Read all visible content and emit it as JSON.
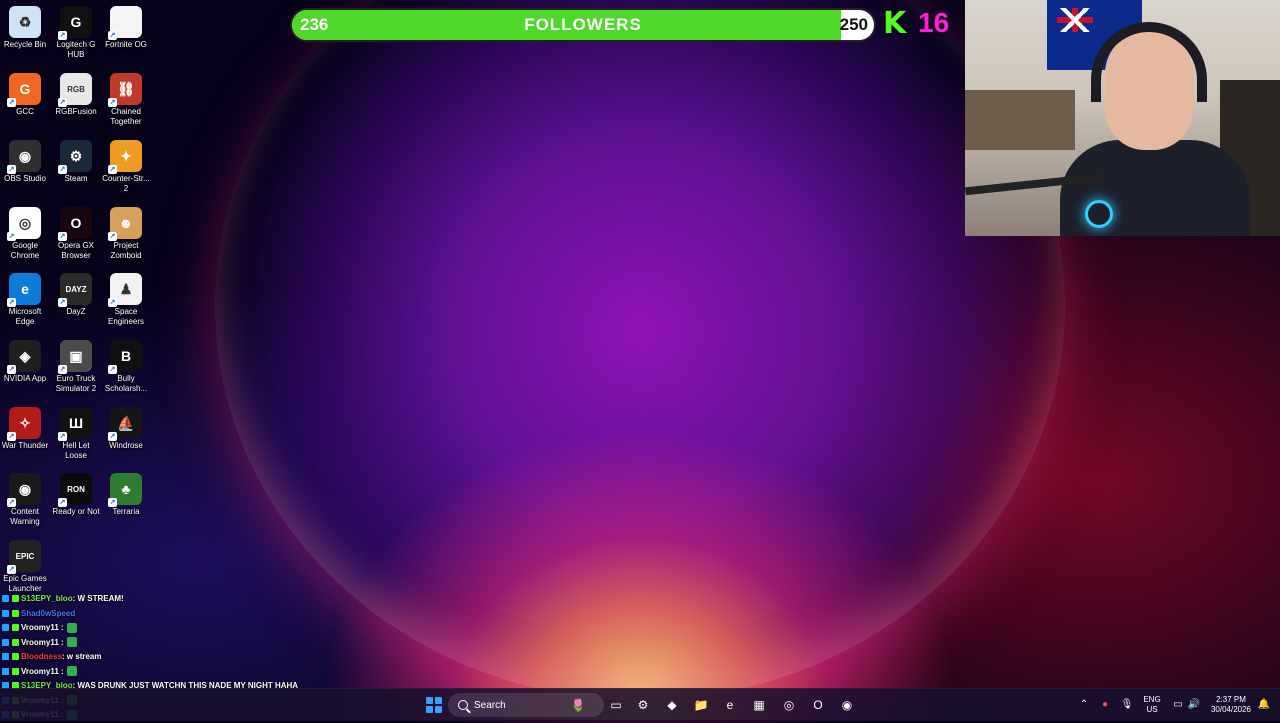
{
  "desktop_icons": [
    {
      "label": "Recycle Bin",
      "icon": "recycle-bin-icon",
      "color": "#cfe3f5",
      "glyph": "♻"
    },
    {
      "label": "Logitech G HUB",
      "icon": "logitech-g-hub-icon",
      "color": "#111111",
      "glyph": "G"
    },
    {
      "label": "Fortnite OG",
      "icon": "file-icon",
      "color": "#f4f4f4",
      "glyph": ""
    },
    {
      "label": "GCC",
      "icon": "gcc-icon",
      "color": "#f26522",
      "glyph": "G"
    },
    {
      "label": "RGBFusion",
      "icon": "rgbfusion-icon",
      "color": "#e8e8e8",
      "glyph": "RGB"
    },
    {
      "label": "Chained Together",
      "icon": "chained-together-icon",
      "color": "#c03a2b",
      "glyph": "⛓"
    },
    {
      "label": "OBS Studio",
      "icon": "obs-studio-icon",
      "color": "#302e31",
      "glyph": "◉"
    },
    {
      "label": "Steam",
      "icon": "steam-icon",
      "color": "#1b2838",
      "glyph": "⚙"
    },
    {
      "label": "Counter-Str... 2",
      "icon": "counter-strike-icon",
      "color": "#f09c24",
      "glyph": "✦"
    },
    {
      "label": "Google Chrome",
      "icon": "google-chrome-icon",
      "color": "#ffffff",
      "glyph": "◎"
    },
    {
      "label": "Opera GX Browser",
      "icon": "opera-gx-icon",
      "color": "#1a0610",
      "glyph": "O"
    },
    {
      "label": "Project Zomboid",
      "icon": "project-zomboid-icon",
      "color": "#d8a15a",
      "glyph": "☻"
    },
    {
      "label": "Microsoft Edge",
      "icon": "microsoft-edge-icon",
      "color": "#0f7bd8",
      "glyph": "e"
    },
    {
      "label": "DayZ",
      "icon": "dayz-icon",
      "color": "#2a2a2a",
      "glyph": "DAYZ"
    },
    {
      "label": "Space Engineers",
      "icon": "space-engineers-icon",
      "color": "#f2f2f2",
      "glyph": "♟"
    },
    {
      "label": "NVIDIA App",
      "icon": "nvidia-app-icon",
      "color": "#1f1f1f",
      "glyph": "◈"
    },
    {
      "label": "Euro Truck Simulator 2",
      "icon": "euro-truck-simulator-icon",
      "color": "#4b4b4b",
      "glyph": "▣"
    },
    {
      "label": "Bully Scholarsh...",
      "icon": "bully-icon",
      "color": "#101010",
      "glyph": "B"
    },
    {
      "label": "War Thunder",
      "icon": "war-thunder-icon",
      "color": "#b51a1a",
      "glyph": "✧"
    },
    {
      "label": "Hell Let Loose",
      "icon": "hell-let-loose-icon",
      "color": "#111111",
      "glyph": "Ш"
    },
    {
      "label": "Windrose",
      "icon": "windrose-icon",
      "color": "#151515",
      "glyph": "⛵"
    },
    {
      "label": "Content Warning",
      "icon": "content-warning-icon",
      "color": "#1a1a1a",
      "glyph": "◉"
    },
    {
      "label": "Ready or Not",
      "icon": "ready-or-not-icon",
      "color": "#0b0b0b",
      "glyph": "RON"
    },
    {
      "label": "Terraria",
      "icon": "terraria-icon",
      "color": "#2e7d32",
      "glyph": "♣"
    },
    {
      "label": "Epic Games Launcher",
      "icon": "epic-games-icon",
      "color": "#222222",
      "glyph": "EPIC"
    }
  ],
  "followers": {
    "start": "236",
    "title": "FOLLOWERS",
    "goal": "250",
    "current": 236,
    "target": 250,
    "fill_color": "#4ed82a"
  },
  "kick": {
    "logo": "K",
    "viewer_count": "16"
  },
  "chat": [
    {
      "user": "S13EPY_bloo",
      "user_color": "#7ee84a",
      "message": ": W STREAM!"
    },
    {
      "user": "Shad0wSpeed",
      "user_color": "#4b73ff",
      "message": ""
    },
    {
      "user": "Vroomy11",
      "user_color": "#ffffff",
      "message": " :"
    },
    {
      "user": "Vroomy11",
      "user_color": "#ffffff",
      "message": " :"
    },
    {
      "user": "Bloodness",
      "user_color": "#ff3b3b",
      "message": ": w stream"
    },
    {
      "user": "Vroomy11",
      "user_color": "#ffffff",
      "message": " :"
    },
    {
      "user": "S13EPY_bloo",
      "user_color": "#7ee84a",
      "message": ": WAS DRUNK JUST WATCHN THIS NADE MY NIGHT HAHA"
    },
    {
      "user": "Vroomy11",
      "user_color": "#ffffff",
      "message": " :"
    },
    {
      "user": "Vroomy11",
      "user_color": "#ffffff",
      "message": " :"
    }
  ],
  "taskbar": {
    "search_placeholder": "Search",
    "apps": [
      {
        "name": "widgets-icon",
        "glyph": "🌷"
      },
      {
        "name": "task-view-icon",
        "glyph": "▭"
      },
      {
        "name": "settings-icon",
        "glyph": "⚙"
      },
      {
        "name": "copilot-icon",
        "glyph": "◆"
      },
      {
        "name": "file-explorer-icon",
        "glyph": "📁"
      },
      {
        "name": "edge-icon",
        "glyph": "e"
      },
      {
        "name": "store-icon",
        "glyph": "▦"
      },
      {
        "name": "chrome-icon",
        "glyph": "◎"
      },
      {
        "name": "opera-gx-icon",
        "glyph": "O"
      },
      {
        "name": "obs-icon",
        "glyph": "◉"
      }
    ],
    "language": "ENG",
    "region": "US",
    "time": "2:37 PM",
    "date": "30/04/2026"
  }
}
